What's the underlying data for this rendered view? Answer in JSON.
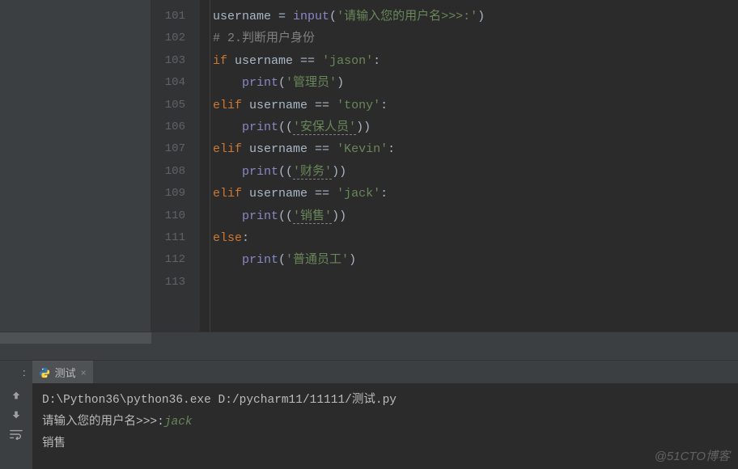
{
  "editor": {
    "lines": [
      {
        "num": "101",
        "tokens": [
          {
            "cls": "tok-var",
            "t": "username"
          },
          {
            "cls": "tok-op",
            "t": " = "
          },
          {
            "cls": "tok-builtin",
            "t": "input"
          },
          {
            "cls": "tok-op",
            "t": "("
          },
          {
            "cls": "tok-str",
            "t": "'请输入您的用户名>>>:'"
          },
          {
            "cls": "tok-op",
            "t": ")"
          }
        ]
      },
      {
        "num": "102",
        "tokens": [
          {
            "cls": "tok-cmt",
            "t": "# 2.判断用户身份"
          }
        ]
      },
      {
        "num": "103",
        "tokens": [
          {
            "cls": "tok-kw",
            "t": "if"
          },
          {
            "cls": "tok-op",
            "t": " "
          },
          {
            "cls": "tok-var",
            "t": "username"
          },
          {
            "cls": "tok-op",
            "t": " == "
          },
          {
            "cls": "tok-str",
            "t": "'jason'"
          },
          {
            "cls": "tok-op",
            "t": ":"
          }
        ]
      },
      {
        "num": "104",
        "tokens": [
          {
            "cls": "tok-op",
            "t": "    "
          },
          {
            "cls": "tok-builtin",
            "t": "print"
          },
          {
            "cls": "tok-op",
            "t": "("
          },
          {
            "cls": "tok-str",
            "t": "'管理员'"
          },
          {
            "cls": "tok-op",
            "t": ")"
          }
        ]
      },
      {
        "num": "105",
        "tokens": [
          {
            "cls": "tok-kw",
            "t": "elif"
          },
          {
            "cls": "tok-op",
            "t": " "
          },
          {
            "cls": "tok-var",
            "t": "username"
          },
          {
            "cls": "tok-op",
            "t": " == "
          },
          {
            "cls": "tok-str",
            "t": "'tony'"
          },
          {
            "cls": "tok-op",
            "t": ":"
          }
        ]
      },
      {
        "num": "106",
        "tokens": [
          {
            "cls": "tok-op",
            "t": "    "
          },
          {
            "cls": "tok-builtin",
            "t": "print"
          },
          {
            "cls": "tok-op",
            "t": "(("
          },
          {
            "cls": "tok-warn",
            "t": "'安保人员'"
          },
          {
            "cls": "tok-op",
            "t": "))"
          }
        ]
      },
      {
        "num": "107",
        "tokens": [
          {
            "cls": "tok-kw",
            "t": "elif"
          },
          {
            "cls": "tok-op",
            "t": " "
          },
          {
            "cls": "tok-var",
            "t": "username"
          },
          {
            "cls": "tok-op",
            "t": " == "
          },
          {
            "cls": "tok-str",
            "t": "'Kevin'"
          },
          {
            "cls": "tok-op",
            "t": ":"
          }
        ]
      },
      {
        "num": "108",
        "tokens": [
          {
            "cls": "tok-op",
            "t": "    "
          },
          {
            "cls": "tok-builtin",
            "t": "print"
          },
          {
            "cls": "tok-op",
            "t": "(("
          },
          {
            "cls": "tok-warn",
            "t": "'财务'"
          },
          {
            "cls": "tok-op",
            "t": "))"
          }
        ]
      },
      {
        "num": "109",
        "tokens": [
          {
            "cls": "tok-kw",
            "t": "elif"
          },
          {
            "cls": "tok-op",
            "t": " "
          },
          {
            "cls": "tok-var",
            "t": "username"
          },
          {
            "cls": "tok-op",
            "t": " == "
          },
          {
            "cls": "tok-str",
            "t": "'jack'"
          },
          {
            "cls": "tok-op",
            "t": ":"
          }
        ]
      },
      {
        "num": "110",
        "tokens": [
          {
            "cls": "tok-op",
            "t": "    "
          },
          {
            "cls": "tok-builtin",
            "t": "print"
          },
          {
            "cls": "tok-op",
            "t": "(("
          },
          {
            "cls": "tok-warn",
            "t": "'销售'"
          },
          {
            "cls": "tok-op",
            "t": "))"
          }
        ]
      },
      {
        "num": "111",
        "tokens": [
          {
            "cls": "tok-kw",
            "t": "else"
          },
          {
            "cls": "tok-op",
            "t": ":"
          }
        ]
      },
      {
        "num": "112",
        "tokens": [
          {
            "cls": "tok-op",
            "t": "    "
          },
          {
            "cls": "tok-builtin",
            "t": "print"
          },
          {
            "cls": "tok-op",
            "t": "("
          },
          {
            "cls": "tok-str",
            "t": "'普通员工'"
          },
          {
            "cls": "tok-op",
            "t": ")"
          }
        ]
      },
      {
        "num": "113",
        "tokens": []
      }
    ]
  },
  "run": {
    "tab_caption": "测试",
    "cmd": "D:\\Python36\\python36.exe D:/pycharm11/11111/测试.py",
    "prompt": "请输入您的用户名>>>:",
    "user_input": "jack",
    "output_line": "销售"
  },
  "watermark": "@51CTO博客"
}
